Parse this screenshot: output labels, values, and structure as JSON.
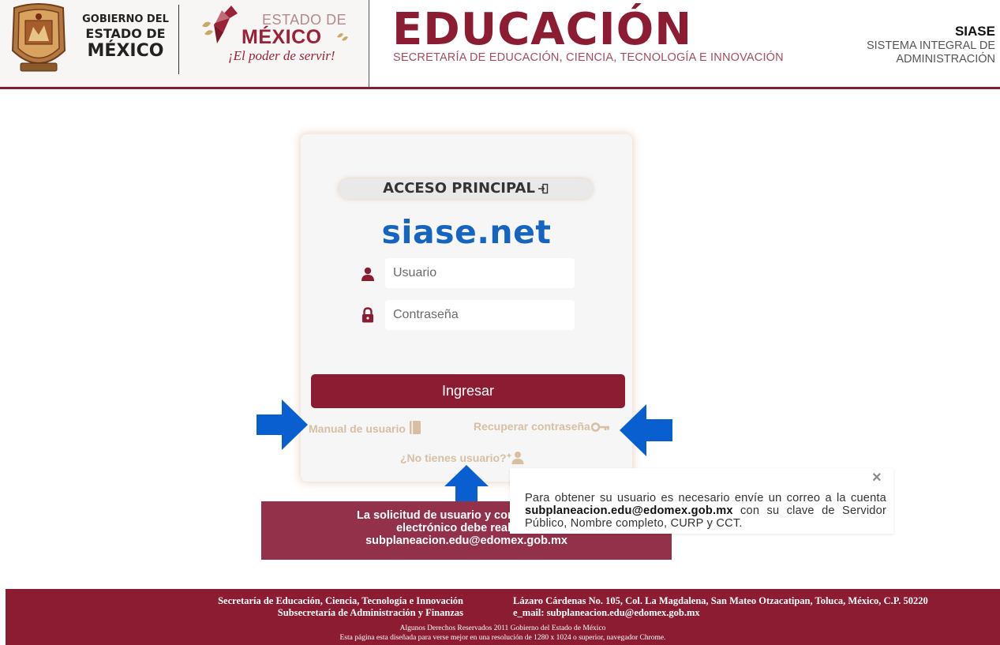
{
  "header": {
    "gob_line1": "GOBIERNO DEL",
    "gob_line2": "ESTADO DE",
    "gob_line3": "MÉXICO",
    "edo_line1": "ESTADO DE",
    "edo_line2": "MÉXICO",
    "edo_slogan": "¡El poder de servir!",
    "edu_title": "EDUCACIÓN",
    "edu_subtitle": "SECRETARÍA DE EDUCACIÓN, CIENCIA, TECNOLOGÍA E INNOVACIÓN",
    "siase_title": "SIASE",
    "siase_line1": "SISTEMA INTEGRAL DE",
    "siase_line2": "ADMINISTRACIÓN"
  },
  "login": {
    "heading": "ACCESO PRINCIPAL",
    "brand": "siase.net",
    "user_placeholder": "Usuario",
    "password_placeholder": "Contraseña",
    "submit_label": "Ingresar",
    "manual_link": "Manual de usuario",
    "recover_link": "Recuperar contraseña",
    "no_user_link": "¿No tienes usuario?"
  },
  "banner": {
    "line1": "La solicitud de usuario y contraseña par",
    "line2": "electrónico debe realizars",
    "line3": "subplaneacion.edu@edomex.gob.mx"
  },
  "popup": {
    "close": "×",
    "text_before": "Para obtener su usuario es necesario envíe un correo a la cuenta ",
    "email": "subplaneacion.edu@edomex.gob.mx",
    "text_after": " con su clave de Servidor Público, Nombre completo, CURP y CCT."
  },
  "footer": {
    "left_line1": "Secretaría de Educación, Ciencia, Tecnología e Innovación",
    "left_line2": "Subsecretaría de Administración y Finanzas",
    "right_line1": "Lázaro Cárdenas No. 105, Col. La Magdalena, San Mateo Otzacatipan, Toluca, México, C.P. 50220",
    "right_line2": "e_mail: subplaneacion.edu@edomex.gob.mx",
    "bottom_line1": "Algunos Derechos Reservados 2011 Gobierno del Estado de México",
    "bottom_line2": "Esta página esta diseñada para verse mejor en una resolución de 1280 x 1024 o superior, navegador Chrome."
  },
  "colors": {
    "brand": "#8b1c32",
    "banner": "#93304a",
    "link": "#d6bfa2",
    "accent_blue": "#1565c0",
    "arrow_blue": "#0a5fd0"
  },
  "icons": [
    "state-seal-icon",
    "hummingbird-logo-icon",
    "login-enter-icon",
    "user-icon",
    "lock-icon",
    "book-icon",
    "key-icon",
    "add-user-icon",
    "arrow-right-icon",
    "arrow-left-icon",
    "arrow-up-icon",
    "close-icon"
  ]
}
